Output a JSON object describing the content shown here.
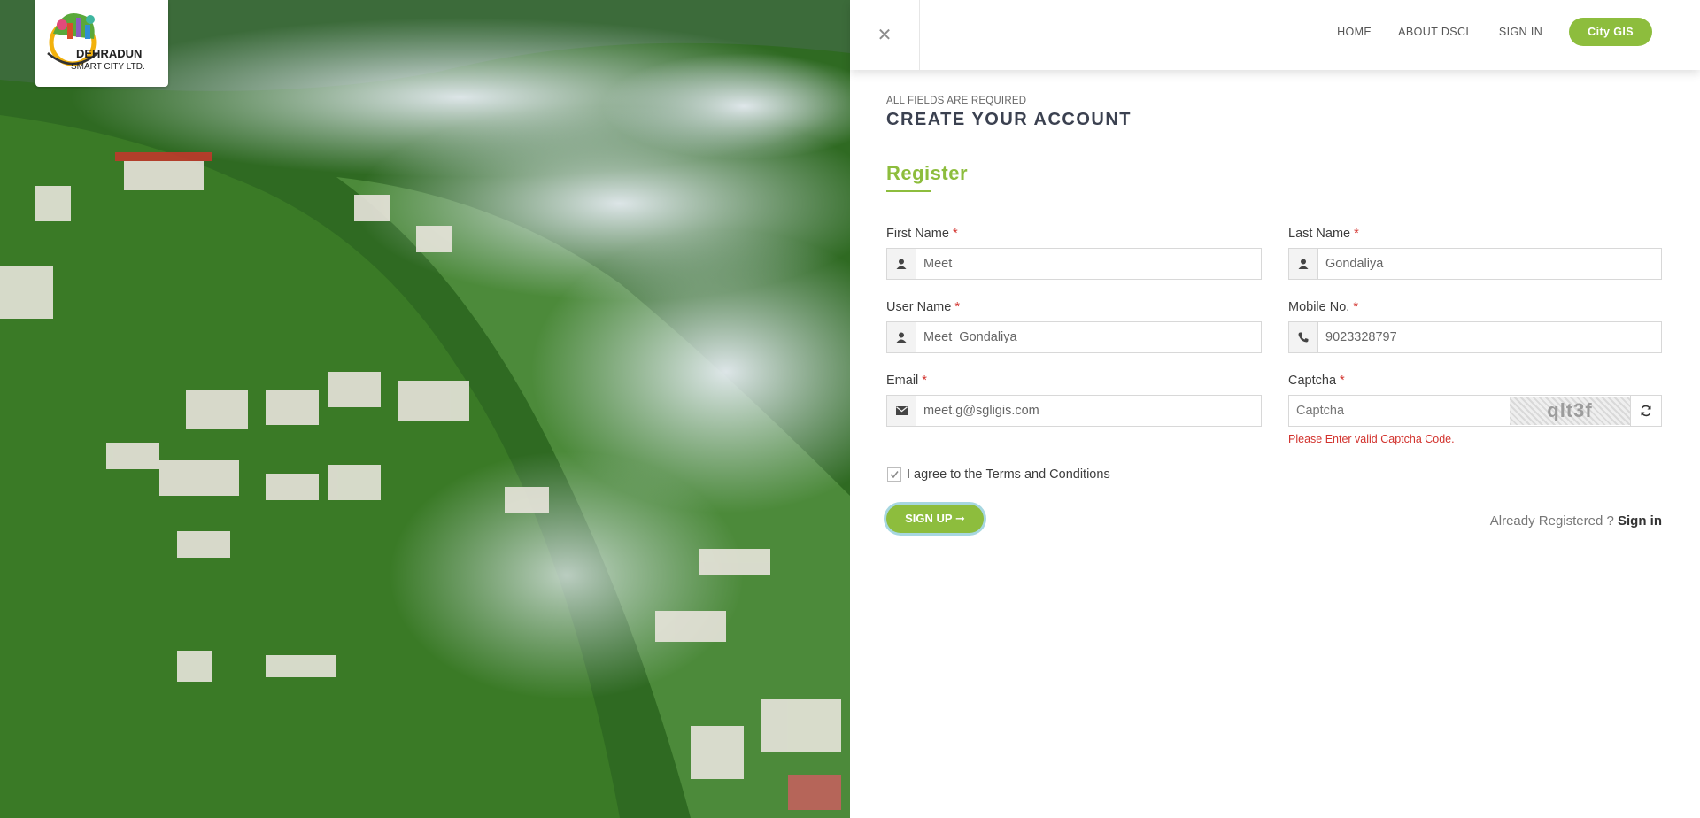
{
  "brand": {
    "line1": "DEHRADUN",
    "line2": "SMART CITY LTD."
  },
  "nav": {
    "home": "HOME",
    "about": "ABOUT DSCL",
    "signin": "SIGN IN",
    "city_gis": "City GIS",
    "close": "✕"
  },
  "form": {
    "required_note": "ALL FIELDS ARE REQUIRED",
    "heading": "CREATE YOUR ACCOUNT",
    "register": "Register",
    "first_name": {
      "label": "First Name",
      "value": "Meet"
    },
    "last_name": {
      "label": "Last Name",
      "value": "Gondaliya"
    },
    "user_name": {
      "label": "User Name",
      "value": "Meet_Gondaliya"
    },
    "mobile": {
      "label": "Mobile No.",
      "value": "9023328797"
    },
    "email": {
      "label": "Email",
      "value": "meet.g@sgligis.com"
    },
    "captcha": {
      "label": "Captcha",
      "placeholder": "Captcha",
      "image_text": "qlt3f",
      "error": "Please Enter valid Captcha Code."
    },
    "required_star": "*",
    "agree_text": "I agree to the",
    "terms_link": "Terms and Conditions",
    "signup_button": "SIGN UP ➞",
    "already_text": "Already Registered ?",
    "signin_link": "Sign in"
  },
  "colors": {
    "accent": "#8dbd3d",
    "error": "#d2322d",
    "heading": "#3b4150"
  }
}
